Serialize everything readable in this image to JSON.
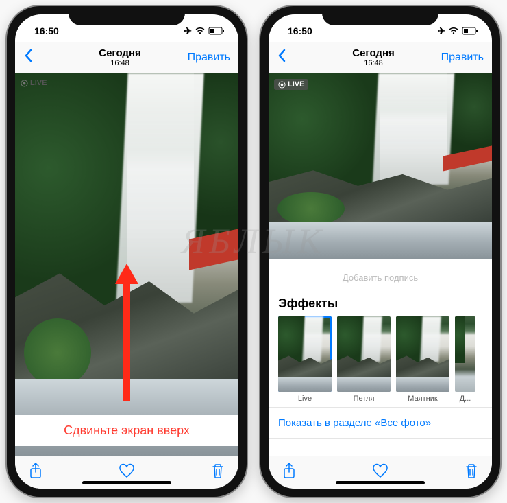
{
  "watermark": "ЯБЛЫК",
  "status": {
    "time": "16:50"
  },
  "nav": {
    "title": "Сегодня",
    "subtitle": "16:48",
    "edit": "Править"
  },
  "live_badge": "LIVE",
  "left": {
    "instruction": "Сдвиньте экран вверх"
  },
  "right": {
    "caption_placeholder": "Добавить подпись",
    "effects_title": "Эффекты",
    "effects": [
      {
        "label": "Live",
        "selected": true
      },
      {
        "label": "Петля",
        "selected": false
      },
      {
        "label": "Маятник",
        "selected": false
      },
      {
        "label": "Д...",
        "selected": false
      }
    ],
    "show_all_link": "Показать в разделе «Все фото»"
  }
}
